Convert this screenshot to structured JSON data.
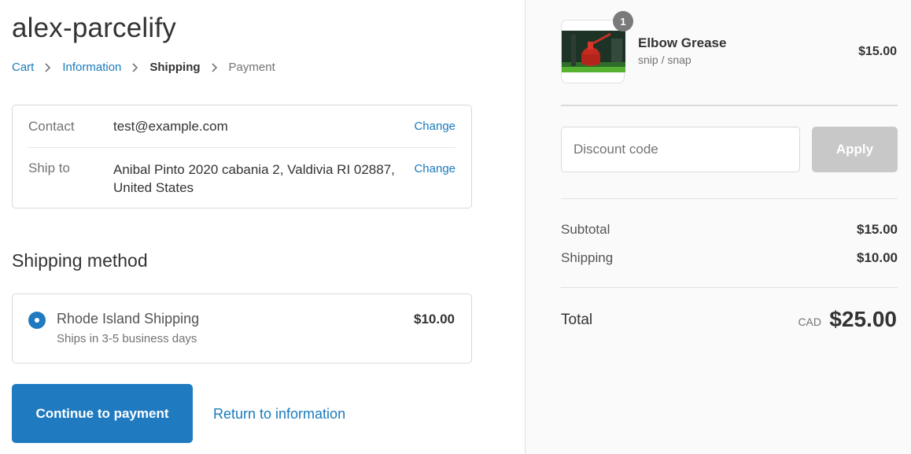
{
  "shop": {
    "title": "alex-parcelify"
  },
  "breadcrumb": {
    "items": [
      {
        "label": "Cart",
        "state": "link"
      },
      {
        "label": "Information",
        "state": "link"
      },
      {
        "label": "Shipping",
        "state": "current"
      },
      {
        "label": "Payment",
        "state": "future"
      }
    ],
    "separator_icon": "chevron-right-icon"
  },
  "review": {
    "contact": {
      "label": "Contact",
      "value": "test@example.com",
      "action": "Change"
    },
    "ship_to": {
      "label": "Ship to",
      "value": "Anibal Pinto 2020 cabania 2, Valdivia RI 02887, United States",
      "action": "Change"
    }
  },
  "shipping_method": {
    "title": "Shipping method",
    "options": [
      {
        "name": "Rhode Island Shipping",
        "description": "Ships in 3-5 business days",
        "price": "$10.00",
        "selected": true
      }
    ]
  },
  "actions": {
    "continue_label": "Continue to payment",
    "return_label": "Return to information"
  },
  "order_summary": {
    "items": [
      {
        "name": "Elbow Grease",
        "variant": "snip / snap",
        "price": "$15.00",
        "quantity": "1"
      }
    ],
    "discount": {
      "placeholder": "Discount code",
      "apply_label": "Apply"
    },
    "subtotal": {
      "label": "Subtotal",
      "value": "$15.00"
    },
    "shipping": {
      "label": "Shipping",
      "value": "$10.00"
    },
    "total": {
      "label": "Total",
      "currency": "CAD",
      "value": "$25.00"
    }
  },
  "colors": {
    "accent": "#1f7ac0",
    "link": "#197bbd",
    "sidebar_bg": "#fafafa",
    "apply_disabled": "#c8c8c8"
  }
}
